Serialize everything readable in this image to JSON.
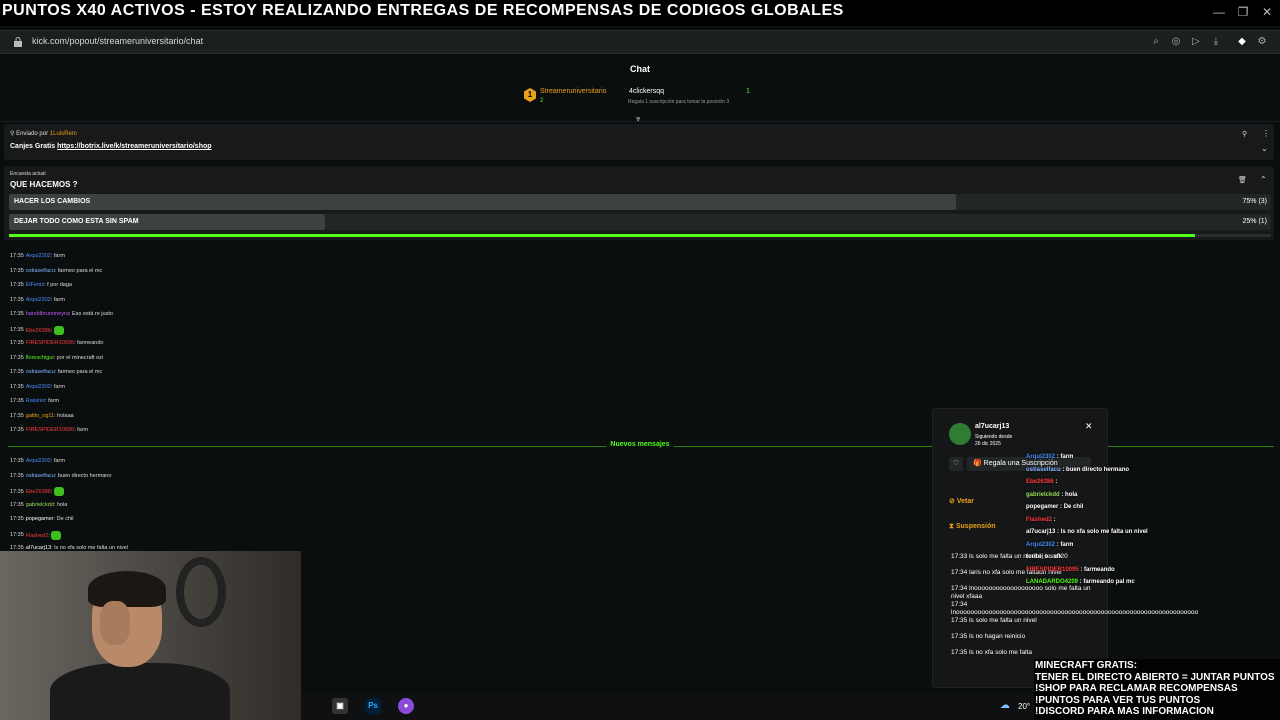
{
  "window": {
    "title": "PUNTOS X40 ACTIVOS - ESTOY REALIZANDO ENTREGAS DE RECOMPENSAS DE CODIGOS GLOBALES",
    "url": "kick.com/popout/streameruniversitario/chat"
  },
  "header": {
    "chat_title": "Chat",
    "leaderboard": {
      "rank": "1",
      "name": "Streameruniversitario",
      "subs": "2",
      "gifter": "4clickersqq",
      "gifter_note": "Regala 1 suscripción para tomar la posición 3",
      "gift_count": "1"
    }
  },
  "pinned": {
    "sender_prefix": "Enviado por",
    "sender": "1LuisRem",
    "message_prefix": "Canjes Gratis",
    "link": "https://botrix.live/k/streameruniversitario/shop"
  },
  "poll": {
    "label": "Encuesta actual",
    "question": "QUE HACEMOS ?",
    "options": [
      {
        "label": "HACER LOS CAMBIOS",
        "pct": "75% (3)",
        "fraction": 0.75
      },
      {
        "label": "DEJAR TODO COMO ESTA SIN SPAM",
        "pct": "25% (1)",
        "fraction": 0.25
      }
    ],
    "time_remaining": 0.94
  },
  "messages_old": [
    {
      "t": "17:35",
      "user": "Arqui2302",
      "color": "#4a8cff",
      "text": "farm"
    },
    {
      "t": "17:35",
      "user": "ostiaselfacu",
      "color": "#7fb2ff",
      "text": "farmeo para el mc"
    },
    {
      "t": "17:35",
      "user": "ElFenix",
      "color": "#4a8cff",
      "text": "f por daga"
    },
    {
      "t": "17:35",
      "user": "Arqui2302",
      "color": "#4a8cff",
      "text": "farm"
    },
    {
      "t": "17:35",
      "user": "haroldbrunoneyra",
      "color": "#c15cff",
      "text": "Eso está re justo"
    },
    {
      "t": "17:35",
      "user": "Ebe26386",
      "color": "#ff3b3b",
      "text": "",
      "emote": true
    },
    {
      "t": "17:35",
      "user": "FIRESPIDER10095",
      "color": "#ff3b3b",
      "text": "farmeando"
    },
    {
      "t": "17:35",
      "user": "floreschigui",
      "color": "#53fc18",
      "text": "por el minecraft ozi"
    },
    {
      "t": "17:35",
      "user": "ostiaselfacu",
      "color": "#7fb2ff",
      "text": "farmeo para el mc"
    },
    {
      "t": "17:35",
      "user": "Arqui2302",
      "color": "#4a8cff",
      "text": "farm"
    },
    {
      "t": "17:35",
      "user": "Raisinix",
      "color": "#4a8cff",
      "text": "farm"
    },
    {
      "t": "17:35",
      "user": "gatito_og11",
      "color": "#e8a11b",
      "text": "holaaa"
    },
    {
      "t": "17:35",
      "user": "FIRESPIDER10095",
      "color": "#ff3b3b",
      "text": "farm"
    }
  ],
  "new_messages_label": "Nuevos mensajes",
  "messages_new": [
    {
      "t": "17:35",
      "user": "Arqui2302",
      "color": "#4a8cff",
      "text": "farm"
    },
    {
      "t": "17:35",
      "user": "ostiaselfacu",
      "color": "#7fb2ff",
      "text": "buen directo hermano"
    },
    {
      "t": "17:35",
      "user": "Ebe26386",
      "color": "#ff3b3b",
      "text": "",
      "emote": true
    },
    {
      "t": "17:35",
      "user": "gabrielckdd",
      "color": "#9be05a",
      "text": "hola"
    },
    {
      "t": "17:35",
      "user": "popegamer",
      "color": "#ffffff",
      "text": "De chil"
    },
    {
      "t": "17:35",
      "user": "Flashed2",
      "color": "#ff3b3b",
      "text": "",
      "emote": true
    },
    {
      "t": "17:35",
      "user": "al7ucarj13",
      "color": "#ffffff",
      "text": "ls no xfa solo me falta un nivel"
    }
  ],
  "user_card": {
    "name": "al7ucarj13",
    "following_since_label": "Siguiendo desde",
    "following_since": "26 dic 2025",
    "gift_label": "Regala una Suscripción",
    "veto_label": "Vetar",
    "timeout_label": "Suspensión",
    "history": [
      "17:33 ls solo me falta un nivel el level 20",
      "17:34 laris no xfa solo me faltaun nivel",
      "17:34 lnooooooooooooooooooo solo me falta un nivel xfaaa",
      "17:34 lnooooooooooooooooooooooooooooooooooooooooooooooooooooooooooooooooooo",
      "17:35 ls solo me falta un nivel",
      "17:35 ls no hagan reinicio",
      "17:35 ls no xfa solo me falta"
    ]
  },
  "overlay_chat": [
    {
      "user": "Arqui2302",
      "color": "#4a8cff",
      "text": "farm"
    },
    {
      "user": "ostiaselfacu",
      "color": "#7fb2ff",
      "text": "buen directo hermano"
    },
    {
      "user": "Ebe26386",
      "color": "#ff3b3b",
      "text": ""
    },
    {
      "user": "gabrielckdd",
      "color": "#9be05a",
      "text": "hola"
    },
    {
      "user": "popegamer",
      "color": "#ffffff",
      "text": "De chil"
    },
    {
      "user": "Flashed2",
      "color": "#ff3b3b",
      "text": ""
    },
    {
      "user": "al7ucarj13",
      "color": "#ffffff",
      "text": "ls no xfa solo me falta un nivel"
    },
    {
      "user": "Arqui2302",
      "color": "#4a8cff",
      "text": "farm"
    },
    {
      "user": "toribi_o",
      "color": "#ffffff",
      "text": "afk"
    },
    {
      "user": "FIRESPIDER10095",
      "color": "#ff3b3b",
      "text": "farmeando"
    },
    {
      "user": "LANADARDO4209",
      "color": "#53fc18",
      "text": "farmeando pal mc"
    }
  ],
  "info_overlay": [
    "MINECRAFT GRATIS:",
    "TENER EL DIRECTO ABIERTO = JUNTAR PUNTOS",
    "!SHOP PARA RECLAMAR RECOMPENSAS",
    "!PUNTOS PARA VER TUS PUNTOS",
    "!DISCORD PARA MAS INFORMACION"
  ],
  "taskbar": {
    "ps_label": "Ps",
    "temp": "20°"
  },
  "colors": {
    "accent": "#53fc18",
    "gold": "#e8a11b"
  }
}
